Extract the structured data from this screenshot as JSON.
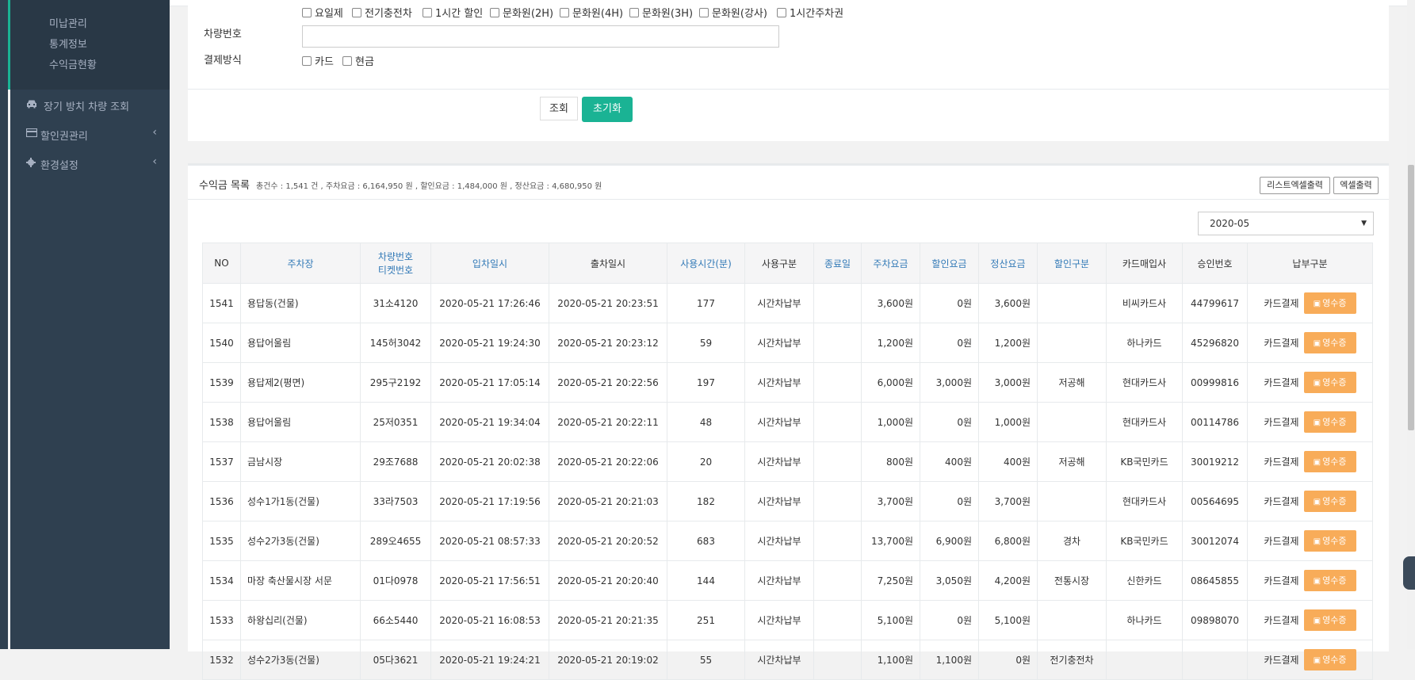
{
  "sidebar": {
    "sub_items": [
      "미납관리",
      "통계정보",
      "수익금현황"
    ],
    "nav": [
      {
        "label": "장기 방치 차량 조회",
        "icon": "car-icon",
        "has_chevron": false
      },
      {
        "label": "할인권관리",
        "icon": "card-icon",
        "has_chevron": true
      },
      {
        "label": "환경설정",
        "icon": "gear-icon",
        "has_chevron": true
      }
    ],
    "chevron": "‹"
  },
  "search": {
    "discount_options": [
      "요일제",
      "전기충전차",
      "1시간 할인",
      "문화원(2H)",
      "문화원(4H)",
      "문화원(3H)",
      "문화원(강사)",
      "1시간주차권"
    ],
    "car_number_label": "차량번호",
    "car_number_value": "",
    "payment_method_label": "결제방식",
    "payment_options": [
      "카드",
      "현금"
    ],
    "search_button": "조회",
    "reset_button": "초기화"
  },
  "list": {
    "title": "수익금 목록",
    "summary": "총건수 : 1,541 건 , 주차요금 : 6,164,950 원 , 할인요금 : 1,484,000 원 , 정산요금 : 4,680,950 원",
    "list_excel_button": "리스트엑셀출력",
    "excel_button": "엑셀출력",
    "month_select": "2020-05",
    "receipt_label": "영수증",
    "columns": [
      {
        "label": "NO",
        "sortable": false
      },
      {
        "label": "주차장",
        "sortable": true
      },
      {
        "label": "차량번호\n티켓번호",
        "sortable": true
      },
      {
        "label": "입차일시",
        "sortable": true
      },
      {
        "label": "출차일시",
        "sortable": false
      },
      {
        "label": "사용시간(분)",
        "sortable": true
      },
      {
        "label": "사용구분",
        "sortable": false
      },
      {
        "label": "종료일",
        "sortable": true
      },
      {
        "label": "주차요금",
        "sortable": true
      },
      {
        "label": "할인요금",
        "sortable": true
      },
      {
        "label": "정산요금",
        "sortable": true
      },
      {
        "label": "할인구분",
        "sortable": true
      },
      {
        "label": "카드매입사",
        "sortable": false
      },
      {
        "label": "승인번호",
        "sortable": false
      },
      {
        "label": "납부구분",
        "sortable": false
      }
    ],
    "rows": [
      {
        "no": "1541",
        "lot": "용답동(건물)",
        "car": "31소4120",
        "in": "2020-05-21 17:26:46",
        "out": "2020-05-21 20:23:51",
        "mins": "177",
        "usage": "시간차납부",
        "end": "",
        "fee": "3,600원",
        "disc": "0원",
        "paid": "3,600원",
        "disc_type": "",
        "card": "비씨카드사",
        "approval": "44799617",
        "pay": "카드결제"
      },
      {
        "no": "1540",
        "lot": "용답어울림",
        "car": "145허3042",
        "in": "2020-05-21 19:24:30",
        "out": "2020-05-21 20:23:12",
        "mins": "59",
        "usage": "시간차납부",
        "end": "",
        "fee": "1,200원",
        "disc": "0원",
        "paid": "1,200원",
        "disc_type": "",
        "card": "하나카드",
        "approval": "45296820",
        "pay": "카드결제"
      },
      {
        "no": "1539",
        "lot": "용답제2(평면)",
        "car": "295구2192",
        "in": "2020-05-21 17:05:14",
        "out": "2020-05-21 20:22:56",
        "mins": "197",
        "usage": "시간차납부",
        "end": "",
        "fee": "6,000원",
        "disc": "3,000원",
        "paid": "3,000원",
        "disc_type": "저공해",
        "card": "현대카드사",
        "approval": "00999816",
        "pay": "카드결제"
      },
      {
        "no": "1538",
        "lot": "용답어울림",
        "car": "25저0351",
        "in": "2020-05-21 19:34:04",
        "out": "2020-05-21 20:22:11",
        "mins": "48",
        "usage": "시간차납부",
        "end": "",
        "fee": "1,000원",
        "disc": "0원",
        "paid": "1,000원",
        "disc_type": "",
        "card": "현대카드사",
        "approval": "00114786",
        "pay": "카드결제"
      },
      {
        "no": "1537",
        "lot": "금남시장",
        "car": "29조7688",
        "in": "2020-05-21 20:02:38",
        "out": "2020-05-21 20:22:06",
        "mins": "20",
        "usage": "시간차납부",
        "end": "",
        "fee": "800원",
        "disc": "400원",
        "paid": "400원",
        "disc_type": "저공해",
        "card": "KB국민카드",
        "approval": "30019212",
        "pay": "카드결제"
      },
      {
        "no": "1536",
        "lot": "성수1가1동(건물)",
        "car": "33라7503",
        "in": "2020-05-21 17:19:56",
        "out": "2020-05-21 20:21:03",
        "mins": "182",
        "usage": "시간차납부",
        "end": "",
        "fee": "3,700원",
        "disc": "0원",
        "paid": "3,700원",
        "disc_type": "",
        "card": "현대카드사",
        "approval": "00564695",
        "pay": "카드결제"
      },
      {
        "no": "1535",
        "lot": "성수2가3동(건물)",
        "car": "289오4655",
        "in": "2020-05-21 08:57:33",
        "out": "2020-05-21 20:20:52",
        "mins": "683",
        "usage": "시간차납부",
        "end": "",
        "fee": "13,700원",
        "disc": "6,900원",
        "paid": "6,800원",
        "disc_type": "경차",
        "card": "KB국민카드",
        "approval": "30012074",
        "pay": "카드결제"
      },
      {
        "no": "1534",
        "lot": "마장 축산물시장 서문",
        "car": "01다0978",
        "in": "2020-05-21 17:56:51",
        "out": "2020-05-21 20:20:40",
        "mins": "144",
        "usage": "시간차납부",
        "end": "",
        "fee": "7,250원",
        "disc": "3,050원",
        "paid": "4,200원",
        "disc_type": "전통시장",
        "card": "신한카드",
        "approval": "08645855",
        "pay": "카드결제"
      },
      {
        "no": "1533",
        "lot": "하왕십리(건물)",
        "car": "66소5440",
        "in": "2020-05-21 16:08:53",
        "out": "2020-05-21 20:21:35",
        "mins": "251",
        "usage": "시간차납부",
        "end": "",
        "fee": "5,100원",
        "disc": "0원",
        "paid": "5,100원",
        "disc_type": "",
        "card": "하나카드",
        "approval": "09898070",
        "pay": "카드결제"
      },
      {
        "no": "1532",
        "lot": "성수2가3동(건물)",
        "car": "05다3621",
        "in": "2020-05-21 19:24:21",
        "out": "2020-05-21 20:19:02",
        "mins": "55",
        "usage": "시간차납부",
        "end": "",
        "fee": "1,100원",
        "disc": "1,100원",
        "paid": "0원",
        "disc_type": "전기충전차",
        "card": "",
        "approval": "",
        "pay": "카드결제"
      }
    ]
  }
}
